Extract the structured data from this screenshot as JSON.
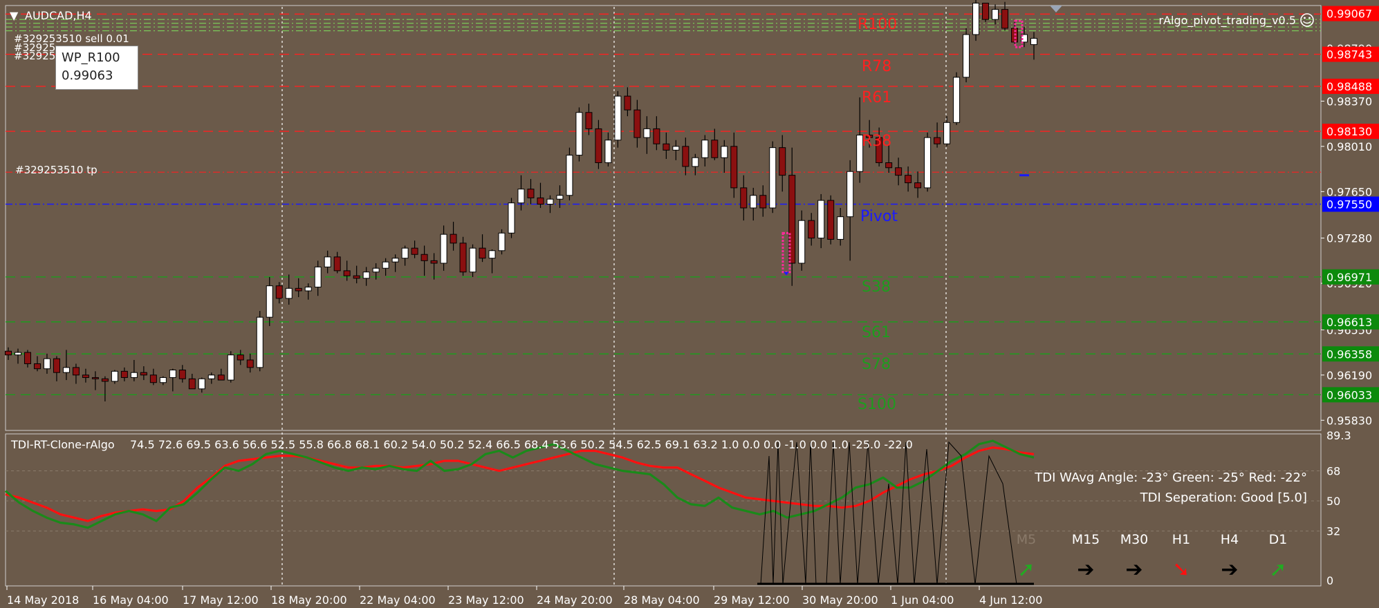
{
  "symbol": "AUDCAD,H4",
  "ea_name": "rAlgo_pivot_trading_v0.5",
  "orders": {
    "line1": "#329253510 sell 0.01",
    "line2": "#32925",
    "line3": "#32925",
    "tp_label": "#329253510 tp"
  },
  "tooltip": {
    "name": "WP_R100",
    "value": "0.99063"
  },
  "pivot_labels": [
    {
      "text": "R100",
      "price": 0.99063,
      "color": "#ff2020"
    },
    {
      "text": "R78",
      "price": 0.98743,
      "color": "#ff2020"
    },
    {
      "text": "R61",
      "price": 0.98488,
      "color": "#ff2020"
    },
    {
      "text": "R38",
      "price": 0.9813,
      "color": "#ff2020"
    },
    {
      "text": "Pivot",
      "price": 0.9755,
      "color": "#1a1aff"
    },
    {
      "text": "S38",
      "price": 0.96971,
      "color": "#1e9c1e"
    },
    {
      "text": "S61",
      "price": 0.96613,
      "color": "#1e9c1e"
    },
    {
      "text": "S78",
      "price": 0.96358,
      "color": "#1e9c1e"
    },
    {
      "text": "S100",
      "price": 0.96033,
      "color": "#1e9c1e"
    }
  ],
  "price_axis": {
    "ticks": [
      "0.98370",
      "0.98010",
      "0.97650",
      "0.97280",
      "0.96920",
      "0.96550",
      "0.96190",
      "0.95830"
    ],
    "tick_values": [
      0.9837,
      0.9801,
      0.9765,
      0.9728,
      0.9692,
      0.9655,
      0.9619,
      0.9583
    ],
    "badges": [
      {
        "text": "0.99067",
        "price": 0.99067,
        "color": "#ff0000"
      },
      {
        "text": "0.98743",
        "price": 0.98743,
        "color": "#ff0000"
      },
      {
        "text": "0.98488",
        "price": 0.98488,
        "color": "#ff0000"
      },
      {
        "text": "0.98130",
        "price": 0.9813,
        "color": "#ff0000"
      },
      {
        "text": "0.97550",
        "price": 0.9755,
        "color": "#0000ff"
      },
      {
        "text": "0.96971",
        "price": 0.96971,
        "color": "#0c8a0c"
      },
      {
        "text": "0.96613",
        "price": 0.96613,
        "color": "#0c8a0c"
      },
      {
        "text": "0.96358",
        "price": 0.96358,
        "color": "#0c8a0c"
      },
      {
        "text": "0.96033",
        "price": 0.96033,
        "color": "#0c8a0c"
      }
    ],
    "current_price": "0.98790"
  },
  "time_axis": [
    "14 May 2018",
    "16 May 04:00",
    "17 May 12:00",
    "18 May 20:00",
    "22 May 04:00",
    "23 May 12:00",
    "24 May 20:00",
    "28 May 04:00",
    "29 May 12:00",
    "30 May 20:00",
    "1 Jun 04:00",
    "4 Jun 12:00"
  ],
  "indicator": {
    "title": "TDI-RT-Clone-rAlgo",
    "values_text": "74.5 72.6 69.5 63.6 56.6 52.5 55.8 66.8 68.1 60.2 54.0 50.2 52.4 66.5 68.4 53.6 50.2 54.5 62.5 69.1 63.2 1.0 0.0 0.0 -1.0 0.0 1.0 -25.0 -22.0",
    "angle_text": "TDI WAvg Angle: -23°  Green: -25°  Red: -22°",
    "separation_text": "TDI Seperation: Good [5.0]",
    "axis": [
      "89.3",
      "68",
      "50",
      "32",
      "0"
    ],
    "axis_values": [
      89.3,
      68,
      50,
      32,
      0
    ],
    "timeframes": [
      {
        "label": "M5",
        "arrow": "up",
        "color": "#22aa22",
        "dim": true
      },
      {
        "label": "M15",
        "arrow": "right",
        "color": "#000000"
      },
      {
        "label": "M30",
        "arrow": "right",
        "color": "#000000"
      },
      {
        "label": "H1",
        "arrow": "down",
        "color": "#ff1010"
      },
      {
        "label": "H4",
        "arrow": "right",
        "color": "#000000"
      },
      {
        "label": "D1",
        "arrow": "up",
        "color": "#22aa22"
      }
    ]
  },
  "chart_data": {
    "type": "candlestick",
    "ylim": [
      0.9576,
      0.9912
    ],
    "candles": [
      [
        0.9638,
        0.9641,
        0.9631,
        0.9635
      ],
      [
        0.9635,
        0.964,
        0.9628,
        0.9637
      ],
      [
        0.9637,
        0.9639,
        0.9625,
        0.9628
      ],
      [
        0.9628,
        0.9634,
        0.9622,
        0.9624
      ],
      [
        0.9624,
        0.9636,
        0.962,
        0.9632
      ],
      [
        0.9632,
        0.9634,
        0.9614,
        0.9621
      ],
      [
        0.9621,
        0.9639,
        0.9615,
        0.9625
      ],
      [
        0.9625,
        0.9628,
        0.9612,
        0.9619
      ],
      [
        0.9619,
        0.9624,
        0.9613,
        0.9617
      ],
      [
        0.9617,
        0.9622,
        0.9607,
        0.9616
      ],
      [
        0.9616,
        0.9618,
        0.9598,
        0.9614
      ],
      [
        0.9614,
        0.9623,
        0.9612,
        0.9622
      ],
      [
        0.9622,
        0.9625,
        0.9614,
        0.9617
      ],
      [
        0.9617,
        0.9631,
        0.9614,
        0.9621
      ],
      [
        0.9621,
        0.9626,
        0.9615,
        0.9619
      ],
      [
        0.9619,
        0.9624,
        0.9611,
        0.9613
      ],
      [
        0.9613,
        0.9618,
        0.9611,
        0.9617
      ],
      [
        0.9617,
        0.9624,
        0.9606,
        0.9623
      ],
      [
        0.9623,
        0.9627,
        0.9613,
        0.9616
      ],
      [
        0.9616,
        0.962,
        0.9611,
        0.9608
      ],
      [
        0.9608,
        0.9617,
        0.9605,
        0.9616
      ],
      [
        0.9616,
        0.9621,
        0.9612,
        0.9619
      ],
      [
        0.9619,
        0.9624,
        0.9615,
        0.9615
      ],
      [
        0.9615,
        0.9638,
        0.9613,
        0.9635
      ],
      [
        0.9635,
        0.9639,
        0.9627,
        0.9631
      ],
      [
        0.9631,
        0.9636,
        0.9621,
        0.9625
      ],
      [
        0.9625,
        0.967,
        0.9622,
        0.9665
      ],
      [
        0.9665,
        0.9697,
        0.9658,
        0.969
      ],
      [
        0.969,
        0.9693,
        0.9676,
        0.968
      ],
      [
        0.968,
        0.9699,
        0.9675,
        0.9688
      ],
      [
        0.9688,
        0.9696,
        0.9681,
        0.9686
      ],
      [
        0.9686,
        0.9692,
        0.9679,
        0.9689
      ],
      [
        0.9689,
        0.971,
        0.9682,
        0.9705
      ],
      [
        0.9705,
        0.9718,
        0.97,
        0.9713
      ],
      [
        0.9713,
        0.9717,
        0.97,
        0.9702
      ],
      [
        0.9702,
        0.971,
        0.9694,
        0.9698
      ],
      [
        0.9698,
        0.9706,
        0.9692,
        0.9696
      ],
      [
        0.9696,
        0.9705,
        0.969,
        0.9701
      ],
      [
        0.9701,
        0.9708,
        0.9695,
        0.9704
      ],
      [
        0.9704,
        0.9712,
        0.9698,
        0.9709
      ],
      [
        0.9709,
        0.9715,
        0.9701,
        0.9712
      ],
      [
        0.9712,
        0.9722,
        0.9706,
        0.972
      ],
      [
        0.972,
        0.9726,
        0.9712,
        0.9715
      ],
      [
        0.9715,
        0.9722,
        0.9698,
        0.971
      ],
      [
        0.971,
        0.9716,
        0.9695,
        0.9708
      ],
      [
        0.9708,
        0.9738,
        0.9702,
        0.9731
      ],
      [
        0.9731,
        0.9741,
        0.9718,
        0.9724
      ],
      [
        0.9724,
        0.9729,
        0.9698,
        0.9701
      ],
      [
        0.9701,
        0.9723,
        0.9697,
        0.972
      ],
      [
        0.972,
        0.9731,
        0.9709,
        0.9712
      ],
      [
        0.9712,
        0.9719,
        0.97,
        0.9718
      ],
      [
        0.9718,
        0.9735,
        0.9715,
        0.9732
      ],
      [
        0.9732,
        0.976,
        0.9728,
        0.9756
      ],
      [
        0.9756,
        0.9778,
        0.975,
        0.9767
      ],
      [
        0.9767,
        0.9775,
        0.9755,
        0.976
      ],
      [
        0.976,
        0.9772,
        0.9752,
        0.9755
      ],
      [
        0.9755,
        0.9762,
        0.9748,
        0.9759
      ],
      [
        0.9759,
        0.977,
        0.9752,
        0.9762
      ],
      [
        0.9762,
        0.98,
        0.9758,
        0.9794
      ],
      [
        0.9794,
        0.9832,
        0.9789,
        0.9828
      ],
      [
        0.9828,
        0.9835,
        0.981,
        0.9815
      ],
      [
        0.9815,
        0.9822,
        0.9783,
        0.9788
      ],
      [
        0.9788,
        0.9812,
        0.9785,
        0.9806
      ],
      [
        0.9806,
        0.9845,
        0.98,
        0.9841
      ],
      [
        0.9841,
        0.9848,
        0.9825,
        0.983
      ],
      [
        0.983,
        0.9838,
        0.98,
        0.9808
      ],
      [
        0.9808,
        0.9825,
        0.9795,
        0.9815
      ],
      [
        0.9815,
        0.9825,
        0.9798,
        0.9803
      ],
      [
        0.9803,
        0.9812,
        0.9791,
        0.9798
      ],
      [
        0.9798,
        0.9806,
        0.979,
        0.9801
      ],
      [
        0.9801,
        0.9808,
        0.9778,
        0.9785
      ],
      [
        0.9785,
        0.9795,
        0.9778,
        0.9792
      ],
      [
        0.9792,
        0.981,
        0.9785,
        0.9806
      ],
      [
        0.9806,
        0.9815,
        0.979,
        0.9792
      ],
      [
        0.9792,
        0.9806,
        0.978,
        0.9801
      ],
      [
        0.9801,
        0.9812,
        0.976,
        0.9768
      ],
      [
        0.9768,
        0.9778,
        0.9742,
        0.9752
      ],
      [
        0.9752,
        0.9768,
        0.9742,
        0.9762
      ],
      [
        0.9762,
        0.977,
        0.9745,
        0.9752
      ],
      [
        0.9752,
        0.9805,
        0.9748,
        0.98
      ],
      [
        0.98,
        0.981,
        0.9765,
        0.9778
      ],
      [
        0.9778,
        0.98,
        0.969,
        0.9708
      ],
      [
        0.9708,
        0.975,
        0.9702,
        0.9742
      ],
      [
        0.9742,
        0.9748,
        0.9722,
        0.9728
      ],
      [
        0.9728,
        0.9763,
        0.972,
        0.9758
      ],
      [
        0.9758,
        0.9762,
        0.9723,
        0.9727
      ],
      [
        0.9727,
        0.9752,
        0.9722,
        0.9745
      ],
      [
        0.9745,
        0.979,
        0.971,
        0.9781
      ],
      [
        0.9781,
        0.984,
        0.9772,
        0.981
      ],
      [
        0.981,
        0.9822,
        0.98,
        0.9808
      ],
      [
        0.9808,
        0.9816,
        0.9785,
        0.9788
      ],
      [
        0.9788,
        0.9802,
        0.978,
        0.9784
      ],
      [
        0.9784,
        0.9792,
        0.977,
        0.9778
      ],
      [
        0.9778,
        0.9785,
        0.9765,
        0.9772
      ],
      [
        0.9772,
        0.9781,
        0.976,
        0.9768
      ],
      [
        0.9768,
        0.9812,
        0.9765,
        0.9808
      ],
      [
        0.9808,
        0.982,
        0.98,
        0.9803
      ],
      [
        0.9803,
        0.9825,
        0.9801,
        0.982
      ],
      [
        0.982,
        0.986,
        0.9818,
        0.9856
      ],
      [
        0.9856,
        0.9895,
        0.9852,
        0.989
      ],
      [
        0.989,
        0.992,
        0.9885,
        0.9915
      ],
      [
        0.9915,
        0.9912,
        0.99,
        0.9902
      ],
      [
        0.9902,
        0.9914,
        0.9898,
        0.991
      ],
      [
        0.991,
        0.9916,
        0.9893,
        0.9895
      ],
      [
        0.9895,
        0.99,
        0.9881,
        0.9884
      ],
      [
        0.9884,
        0.9896,
        0.988,
        0.989
      ],
      [
        0.9882,
        0.9892,
        0.987,
        0.9887
      ]
    ]
  }
}
